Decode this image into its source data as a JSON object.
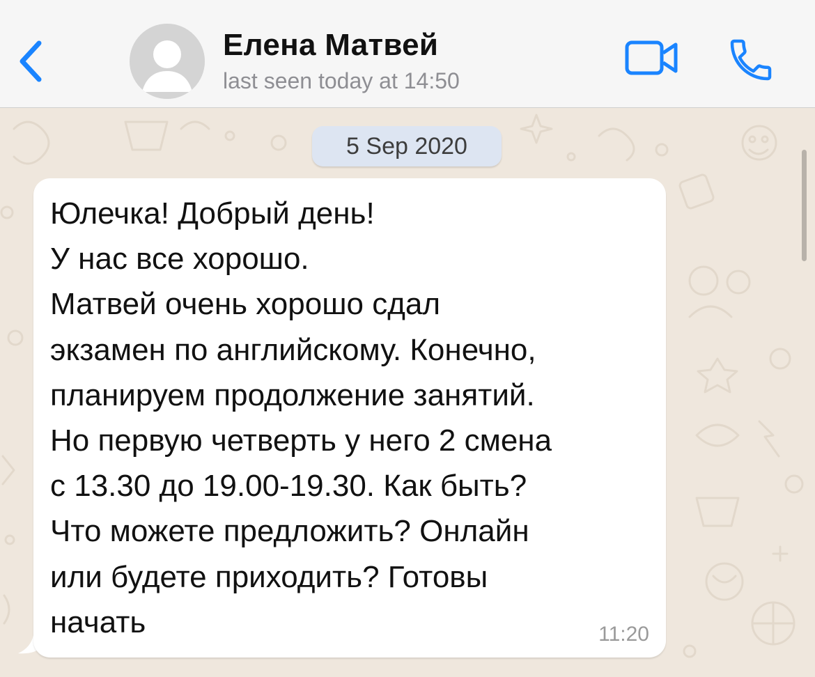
{
  "header": {
    "contact_name": "Елена Матвей",
    "status": "last seen today at 14:50"
  },
  "icons": {
    "back": "chevron-left-icon",
    "avatar": "user-icon",
    "video": "video-camera-icon",
    "call": "phone-icon"
  },
  "colors": {
    "accent": "#1a84ff",
    "chat_background": "#efe7dd",
    "date_pill": "#dde5f2",
    "incoming_bubble": "#ffffff"
  },
  "chat": {
    "date_label": "5 Sep 2020",
    "messages": [
      {
        "direction": "incoming",
        "lines": [
          "Юлечка! Добрый день!",
          "У нас все хорошо.",
          "Матвей очень хорошо сдал",
          "экзамен по английскому. Конечно,",
          "планируем продолжение занятий.",
          "Но первую четверть у него 2 смена",
          "с 13.30 до 19.00-19.30. Как быть?",
          "Что можете предложить? Онлайн",
          "или будете приходить? Готовы",
          "начать"
        ],
        "time": "11:20"
      }
    ]
  }
}
